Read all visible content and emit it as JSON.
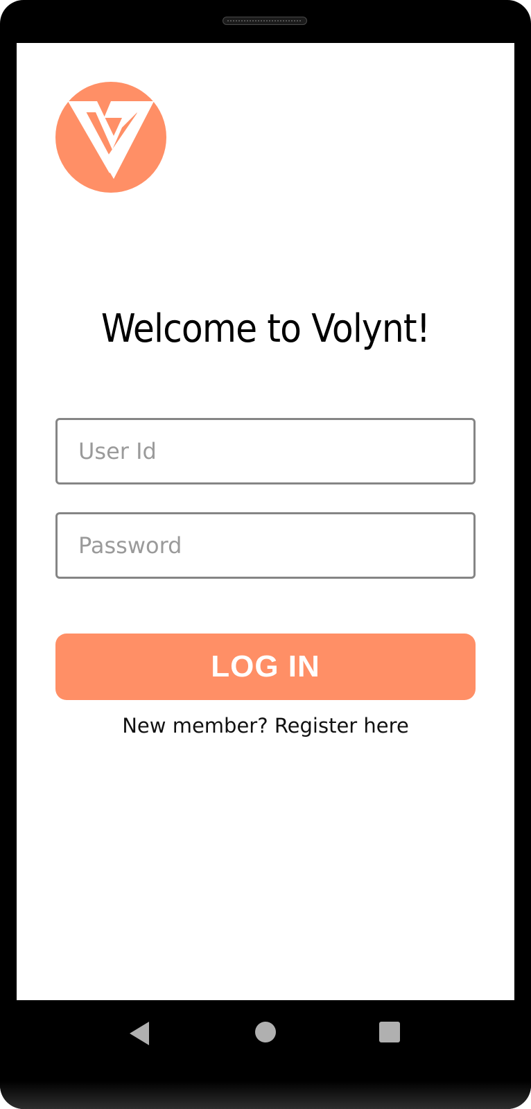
{
  "app": {
    "name": "Volynt",
    "brand_color": "#ff8f66"
  },
  "logo": {
    "icon": "volynt-logo-icon"
  },
  "login": {
    "welcome_title": "Welcome to Volynt!",
    "user_id": {
      "placeholder": "User Id",
      "value": ""
    },
    "password": {
      "placeholder": "Password",
      "value": ""
    },
    "login_button_label": "LOG IN",
    "register_link": "New member? Register here"
  },
  "system_nav": {
    "back_icon": "back-icon",
    "home_icon": "home-icon",
    "recents_icon": "recents-icon"
  }
}
